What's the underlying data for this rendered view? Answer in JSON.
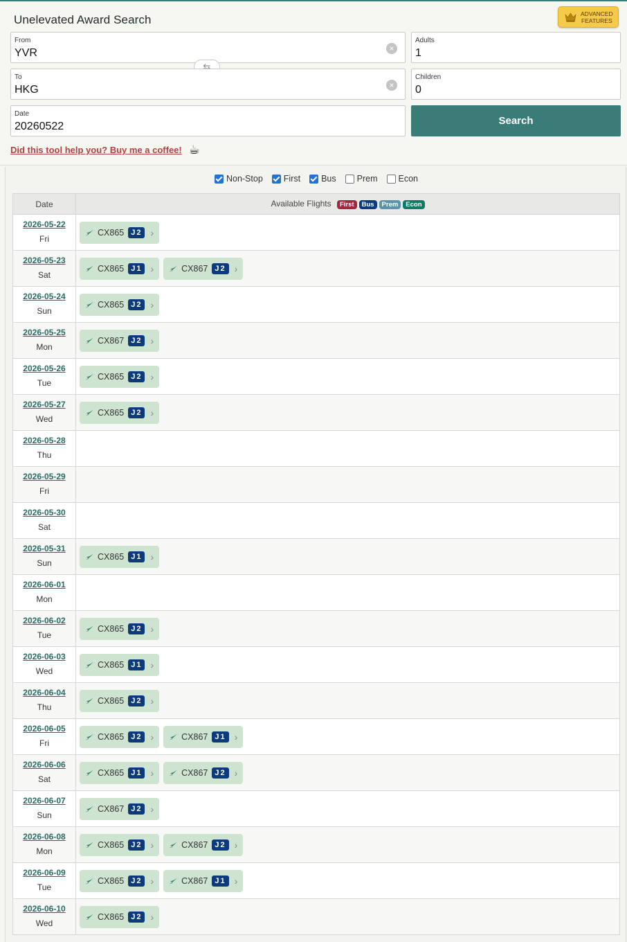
{
  "app": {
    "title": "Unelevated Award Search",
    "advanced_label_line1": "ADVANCED",
    "advanced_label_line2": "FEATURES"
  },
  "form": {
    "from": {
      "label": "From",
      "value": "YVR"
    },
    "to": {
      "label": "To",
      "value": "HKG"
    },
    "date": {
      "label": "Date",
      "value": "20260522"
    },
    "adults": {
      "label": "Adults",
      "value": "1"
    },
    "children": {
      "label": "Children",
      "value": "0"
    },
    "search_label": "Search",
    "clear_icon": "×",
    "swap_icon": "⇆"
  },
  "coffee": {
    "label": "Did this tool help you? Buy me a coffee!",
    "icon": "☕"
  },
  "filters": [
    {
      "label": "Non-Stop",
      "checked": true
    },
    {
      "label": "First",
      "checked": true
    },
    {
      "label": "Bus",
      "checked": true
    },
    {
      "label": "Prem",
      "checked": false
    },
    {
      "label": "Econ",
      "checked": false
    }
  ],
  "table": {
    "col_date": "Date",
    "col_flights": "Available Flights",
    "legend": [
      "First",
      "Bus",
      "Prem",
      "Econ"
    ],
    "rows": [
      {
        "date": "2026-05-22",
        "dow": "Fri",
        "flights": [
          {
            "code": "CX865",
            "cls": "J2"
          }
        ]
      },
      {
        "date": "2026-05-23",
        "dow": "Sat",
        "flights": [
          {
            "code": "CX865",
            "cls": "J1"
          },
          {
            "code": "CX867",
            "cls": "J2"
          }
        ]
      },
      {
        "date": "2026-05-24",
        "dow": "Sun",
        "flights": [
          {
            "code": "CX865",
            "cls": "J2"
          }
        ]
      },
      {
        "date": "2026-05-25",
        "dow": "Mon",
        "flights": [
          {
            "code": "CX867",
            "cls": "J2"
          }
        ]
      },
      {
        "date": "2026-05-26",
        "dow": "Tue",
        "flights": [
          {
            "code": "CX865",
            "cls": "J2"
          }
        ]
      },
      {
        "date": "2026-05-27",
        "dow": "Wed",
        "flights": [
          {
            "code": "CX865",
            "cls": "J2"
          }
        ]
      },
      {
        "date": "2026-05-28",
        "dow": "Thu",
        "flights": []
      },
      {
        "date": "2026-05-29",
        "dow": "Fri",
        "flights": []
      },
      {
        "date": "2026-05-30",
        "dow": "Sat",
        "flights": []
      },
      {
        "date": "2026-05-31",
        "dow": "Sun",
        "flights": [
          {
            "code": "CX865",
            "cls": "J1"
          }
        ]
      },
      {
        "date": "2026-06-01",
        "dow": "Mon",
        "flights": []
      },
      {
        "date": "2026-06-02",
        "dow": "Tue",
        "flights": [
          {
            "code": "CX865",
            "cls": "J2"
          }
        ]
      },
      {
        "date": "2026-06-03",
        "dow": "Wed",
        "flights": [
          {
            "code": "CX865",
            "cls": "J1"
          }
        ]
      },
      {
        "date": "2026-06-04",
        "dow": "Thu",
        "flights": [
          {
            "code": "CX865",
            "cls": "J2"
          }
        ]
      },
      {
        "date": "2026-06-05",
        "dow": "Fri",
        "flights": [
          {
            "code": "CX865",
            "cls": "J2"
          },
          {
            "code": "CX867",
            "cls": "J1"
          }
        ]
      },
      {
        "date": "2026-06-06",
        "dow": "Sat",
        "flights": [
          {
            "code": "CX865",
            "cls": "J1"
          },
          {
            "code": "CX867",
            "cls": "J2"
          }
        ]
      },
      {
        "date": "2026-06-07",
        "dow": "Sun",
        "flights": [
          {
            "code": "CX867",
            "cls": "J2"
          }
        ]
      },
      {
        "date": "2026-06-08",
        "dow": "Mon",
        "flights": [
          {
            "code": "CX865",
            "cls": "J2"
          },
          {
            "code": "CX867",
            "cls": "J2"
          }
        ]
      },
      {
        "date": "2026-06-09",
        "dow": "Tue",
        "flights": [
          {
            "code": "CX865",
            "cls": "J2"
          },
          {
            "code": "CX867",
            "cls": "J1"
          }
        ]
      },
      {
        "date": "2026-06-10",
        "dow": "Wed",
        "flights": [
          {
            "code": "CX865",
            "cls": "J2"
          }
        ]
      }
    ]
  }
}
